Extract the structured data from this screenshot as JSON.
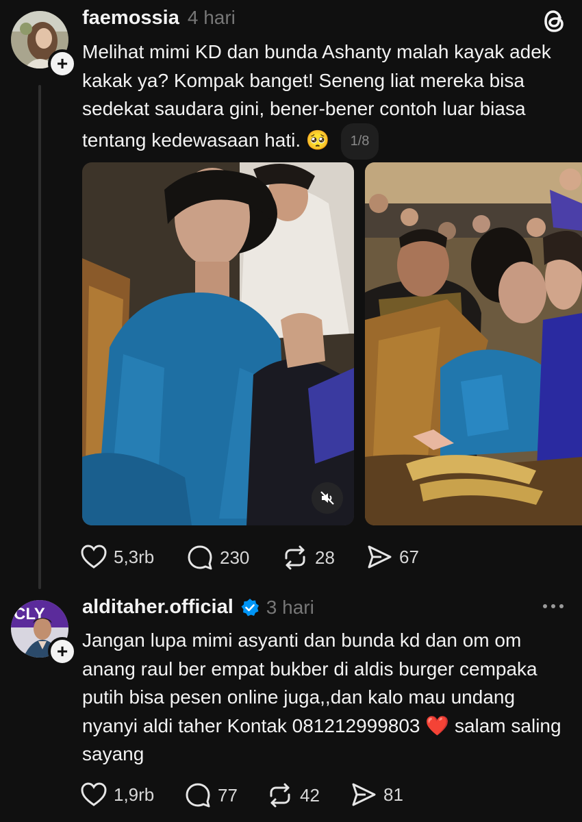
{
  "post1": {
    "username": "faemossia",
    "time": "4 hari",
    "text": "Melihat mimi KD dan bunda Ashanty malah kayak adek kakak ya? Kompak banget! Seneng liat mereka bisa sedekat saudara gini, bener-bener contoh luar biasa tentang kedewasaan hati.",
    "emoji": "🥺",
    "media_counter": "1/8",
    "follow_icon": "plus-icon",
    "app_icon": "threads-logo-icon",
    "mute_icon": "volume-mute-icon",
    "actions": {
      "likes": "5,3rb",
      "replies": "230",
      "reposts": "28",
      "shares": "67"
    }
  },
  "post2": {
    "username": "alditaher.official",
    "verified": true,
    "time": "3 hari",
    "menu_icon": "more-horizontal-icon",
    "text": "Jangan lupa mimi asyanti dan bunda kd dan om om anang raul ber empat bukber di aldis burger cempaka putih bisa pesen online juga,,dan kalo mau undang nyanyi aldi taher Kontak 081212999803",
    "emoji": "❤️",
    "text_end": "salam saling sayang",
    "actions": {
      "likes": "1,9rb",
      "replies": "77",
      "reposts": "42",
      "shares": "81"
    }
  },
  "colors": {
    "background": "#101010",
    "text": "#f3f3f3",
    "muted": "#777777",
    "verified": "#0095f6",
    "heart": "#e0245e"
  }
}
